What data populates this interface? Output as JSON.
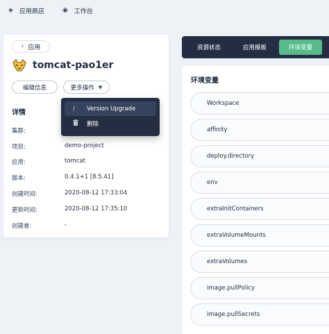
{
  "topbar": {
    "items": [
      {
        "icon": "app-store-icon",
        "label": "应用商店"
      },
      {
        "icon": "workbench-icon",
        "label": "工作台"
      }
    ]
  },
  "left": {
    "back_label": "应用",
    "app_name": "tomcat-pao1er",
    "edit_label": "编辑信息",
    "more_label": "更多操作",
    "section_title": "详情",
    "details": [
      {
        "key": "集群:",
        "value": ""
      },
      {
        "key": "项目:",
        "value": "demo-project"
      },
      {
        "key": "应用:",
        "value": "tomcat"
      },
      {
        "key": "版本:",
        "value": "0.4.1+1 [8.5.41]"
      },
      {
        "key": "创建时间:",
        "value": "2020-08-12 17:33:04"
      },
      {
        "key": "更新时间:",
        "value": "2020-08-12 17:35:10"
      },
      {
        "key": "创建者:",
        "value": "-"
      }
    ]
  },
  "dropdown": {
    "items": [
      {
        "label": "Version Upgrade",
        "icon": "pencil-icon"
      },
      {
        "label": "删除",
        "icon": "trash-icon"
      }
    ]
  },
  "tabs": [
    {
      "label": "资源状态",
      "active": false
    },
    {
      "label": "应用模板",
      "active": false
    },
    {
      "label": "环境变量",
      "active": true
    }
  ],
  "env": {
    "heading": "环境变量",
    "items": [
      "Workspace",
      "affinity",
      "deploy.directory",
      "env",
      "extraInitContainers",
      "extraVolumeMounts",
      "extraVolumes",
      "image.pullPolicy",
      "image.pullSecrets"
    ]
  },
  "colors": {
    "dark": "#242e42",
    "accent_green": "#55bc8a",
    "background": "#eef2f7"
  }
}
